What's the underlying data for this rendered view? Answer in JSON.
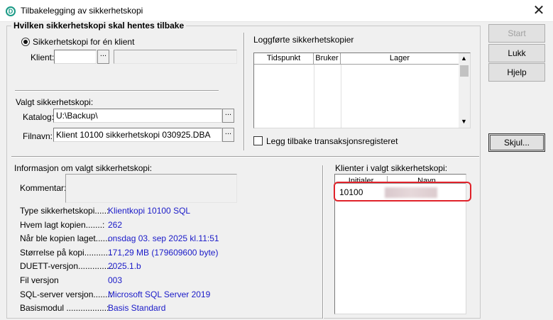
{
  "window": {
    "title": "Tilbakelegging av sikkerhetskopi",
    "close_label": "✕"
  },
  "group_main": {
    "title": "Hvilken sikkerhetskopi skal hentes tilbake"
  },
  "restore_one": {
    "label": "Sikkerhetskopi for én klient",
    "klient_label": "Klient:",
    "klient_value": "",
    "klient_name": ""
  },
  "selected": {
    "title": "Valgt sikkerhetskopi:",
    "katalog_label": "Katalog:",
    "katalog_value": "U:\\Backup\\",
    "filnavn_label": "Filnavn:",
    "filnavn_value": "Klient 10100 sikkerhetskopi 030925.DBA"
  },
  "log": {
    "title": "Loggførte sikkerhetskopier",
    "columns": [
      "Tidspunkt",
      "Bruker",
      "Lager"
    ],
    "checkbox_label": "Legg tilbake transaksjonsregisteret"
  },
  "buttons": {
    "start": "Start",
    "lukk": "Lukk",
    "hjelp": "Hjelp",
    "skjul": "Skjul..."
  },
  "info": {
    "title": "Informasjon om valgt sikkerhetskopi:",
    "kommentar_label": "Kommentar:",
    "rows": [
      {
        "label": "Type sikkerhetskopi.....:",
        "value": "Klientkopi 10100 SQL"
      },
      {
        "label": "Hvem lagt kopien.......:",
        "value": "262"
      },
      {
        "label": "Når ble kopien laget......",
        "value": "onsdag 03. sep 2025 kl.11:51"
      },
      {
        "label": "Størrelse på kopi............",
        "value": "171,29 MB  (179609600 byte)"
      },
      {
        "label": "DUETT-versjon...............",
        "value": "2025.1.b"
      },
      {
        "label": "Fil versjon",
        "value": "003"
      },
      {
        "label": "SQL-server versjon.......:",
        "value": "Microsoft SQL Server 2019"
      },
      {
        "label": "Basismodul .................:",
        "value": "Basis Standard"
      }
    ]
  },
  "clients": {
    "title": "Klienter i valgt sikkerhetskopi:",
    "columns": [
      "Initialer",
      "Navn"
    ],
    "rows": [
      {
        "initials": "10100",
        "name": ""
      }
    ]
  }
}
